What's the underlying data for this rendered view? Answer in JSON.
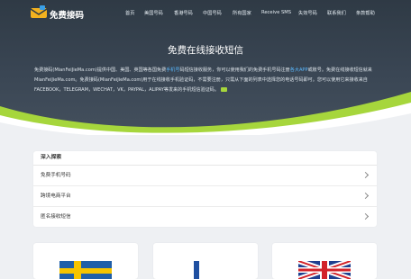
{
  "header": {
    "brand": "免费接码",
    "nav": [
      "首页",
      "美国号码",
      "香港号码",
      "中国号码",
      "所有国家",
      "Receive SMS",
      "失效号码",
      "联系我们",
      "条款帮助"
    ]
  },
  "hero": {
    "title": "免费在线接收短信",
    "desc_1": "免费接码(MianFeiJieMa.com)提供中国、美国、英国等各国免费",
    "desc_link_1": "手机号",
    "desc_2": "码短信接收服务，你可以使用我们的免费手机号码注册",
    "desc_link_2": "各大APP",
    "desc_3": "或账号。免费在线接收短信就来MianFeiJieMa.com。免费接码(MianFeiJieMa.com)用于在线接收手机验证码，不需要注册，只需从下面的列表中选择您的电话号码即可。您可以使用它来接收来自FACEBOOK，TELEGRAM，WECHAT，VK，PAYPAL，ALIPAY等发来的手机短信验证码。"
  },
  "explore": {
    "title": "深入探索",
    "items": [
      "免费手机号码",
      "跨境电商平台",
      "匿名接收短信"
    ]
  },
  "cards": {
    "flags": [
      "sweden-flag-icon",
      "finland-flag-icon",
      "uk-flag-icon"
    ]
  },
  "colors": {
    "hero_dark": "#2f3a45",
    "wave_green": "#a6d63c",
    "link_blue": "#59b8ff",
    "page_bg": "#eef0f3"
  }
}
